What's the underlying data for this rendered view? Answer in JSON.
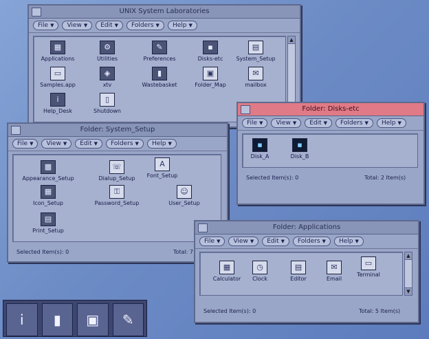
{
  "main_window": {
    "title": "UNIX System Laboratories",
    "menus": [
      "File",
      "View",
      "Edit",
      "Folders",
      "Help"
    ],
    "icons": [
      {
        "label": "Applications",
        "icon": "app-folder-icon"
      },
      {
        "label": "Utilities",
        "icon": "utilities-icon"
      },
      {
        "label": "Preferences",
        "icon": "preferences-icon"
      },
      {
        "label": "Disks-etc",
        "icon": "disks-icon"
      },
      {
        "label": "System_Setup",
        "icon": "system-setup-icon"
      },
      {
        "label": "Samples.app",
        "icon": "folder-icon"
      },
      {
        "label": "xtv",
        "icon": "xtv-icon"
      },
      {
        "label": "Wastebasket",
        "icon": "wastebasket-icon"
      },
      {
        "label": "Folder_Map",
        "icon": "folder-map-icon"
      },
      {
        "label": "mailbox",
        "icon": "mailbox-icon"
      },
      {
        "label": "Help_Desk",
        "icon": "help-desk-icon"
      },
      {
        "label": "Shutdown",
        "icon": "shutdown-icon"
      }
    ]
  },
  "system_setup_window": {
    "title": "Folder: System_Setup",
    "menus": [
      "File",
      "View",
      "Edit",
      "Folders",
      "Help"
    ],
    "icons": [
      {
        "label": "Appearance_Setup",
        "icon": "appearance-icon"
      },
      {
        "label": "Dialup_Setup",
        "icon": "dialup-icon"
      },
      {
        "label": "Font_Setup",
        "icon": "font-icon"
      },
      {
        "label": "Icon_Setup",
        "icon": "icon-setup-icon"
      },
      {
        "label": "Password_Setup",
        "icon": "password-icon"
      },
      {
        "label": "User_Setup",
        "icon": "user-icon"
      },
      {
        "label": "Print_Setup",
        "icon": "print-icon"
      }
    ],
    "selected": "Selected Item(s): 0",
    "total": "Total: 7"
  },
  "disks_window": {
    "title": "Folder: Disks-etc",
    "menus": [
      "File",
      "View",
      "Edit",
      "Folders",
      "Help"
    ],
    "icons": [
      {
        "label": "Disk_A",
        "icon": "floppy-disk-icon"
      },
      {
        "label": "Disk_B",
        "icon": "floppy-disk-icon"
      }
    ],
    "selected": "Selected Item(s): 0",
    "total": "Total: 2 Item(s)"
  },
  "applications_window": {
    "title": "Folder: Applications",
    "menus": [
      "File",
      "View",
      "Edit",
      "Folders",
      "Help"
    ],
    "icons": [
      {
        "label": "Calculator",
        "icon": "calculator-icon"
      },
      {
        "label": "Clock",
        "icon": "clock-icon"
      },
      {
        "label": "Editor",
        "icon": "editor-icon"
      },
      {
        "label": "Email",
        "icon": "email-icon"
      },
      {
        "label": "Terminal",
        "icon": "terminal-icon"
      }
    ],
    "selected": "Selected Item(s): 0",
    "total": "Total: 5 Item(s)"
  },
  "dock": [
    {
      "name": "info-icon",
      "glyph": "i"
    },
    {
      "name": "wastebasket-icon",
      "glyph": "▮"
    },
    {
      "name": "folders-icon",
      "glyph": "▣"
    },
    {
      "name": "preferences-icon",
      "glyph": "✎"
    }
  ],
  "colors": {
    "desktop": "#6f8ec4",
    "window": "#9aa6c7",
    "active_title": "#e07a86"
  }
}
